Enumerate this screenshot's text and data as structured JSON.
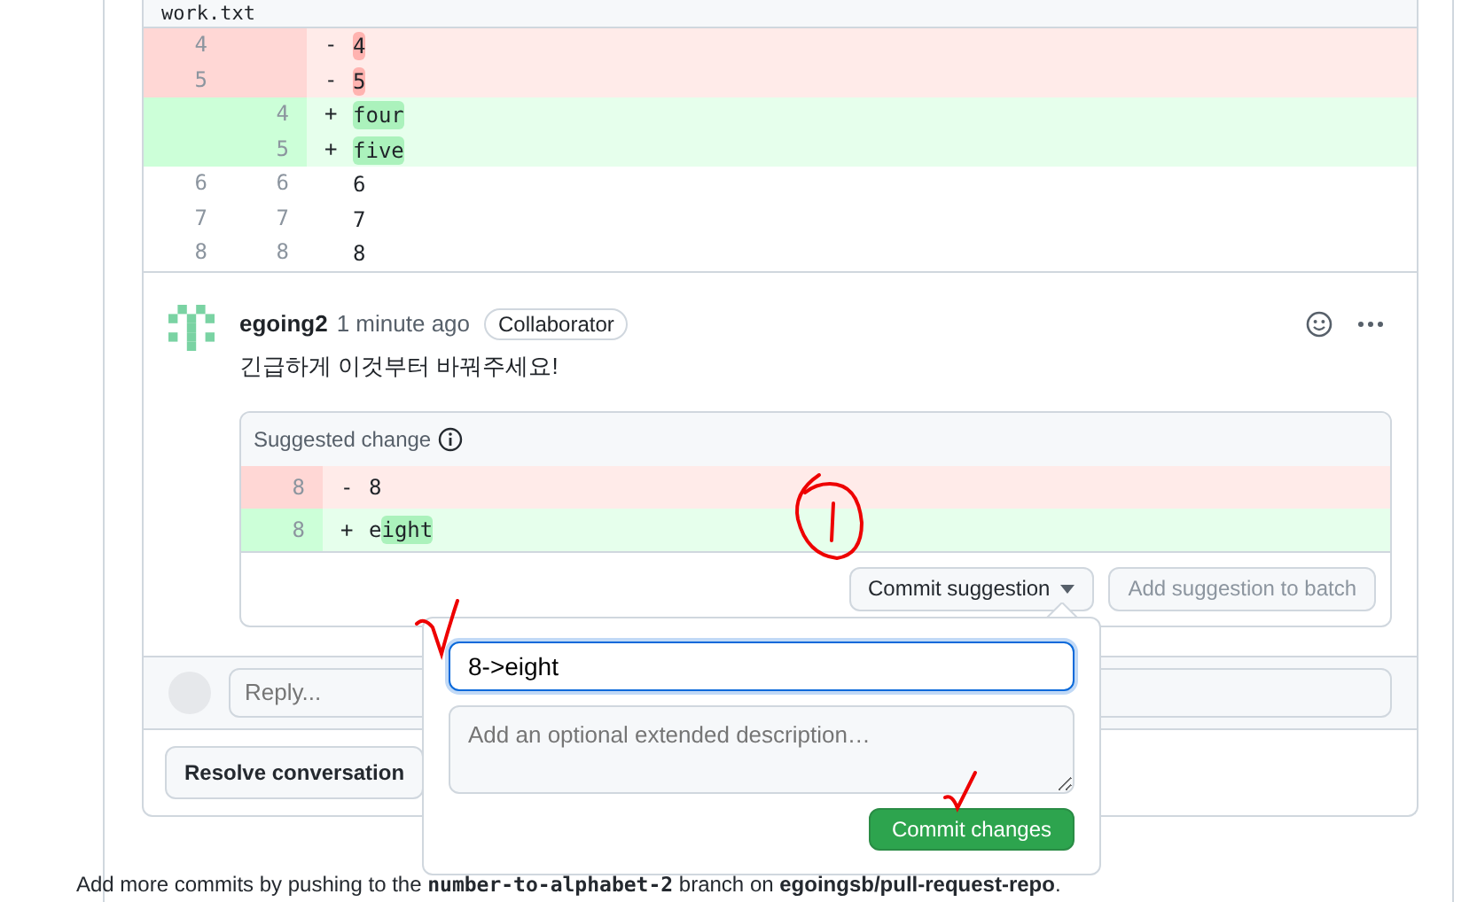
{
  "file": {
    "name": "work.txt",
    "lines": [
      {
        "kind": "deleted",
        "old": "4",
        "sign": "-",
        "segments": [
          {
            "text": "4",
            "marked": true
          }
        ]
      },
      {
        "kind": "deleted",
        "old": "5",
        "sign": "-",
        "segments": [
          {
            "text": "5",
            "marked": true
          }
        ]
      },
      {
        "kind": "added",
        "new": "4",
        "sign": "+",
        "segments": [
          {
            "text": "four",
            "marked": true
          }
        ]
      },
      {
        "kind": "added",
        "new": "5",
        "sign": "+",
        "segments": [
          {
            "text": "five",
            "marked": true
          }
        ]
      },
      {
        "kind": "context",
        "old": "6",
        "new": "6",
        "segments": [
          {
            "text": "6",
            "marked": false
          }
        ]
      },
      {
        "kind": "context",
        "old": "7",
        "new": "7",
        "segments": [
          {
            "text": "7",
            "marked": false
          }
        ]
      },
      {
        "kind": "context",
        "old": "8",
        "new": "8",
        "segments": [
          {
            "text": "8",
            "marked": false
          }
        ]
      }
    ]
  },
  "comment": {
    "author": "egoing2",
    "time": "1 minute ago",
    "badge": "Collaborator",
    "body": "긴급하게 이것부터 바꿔주세요!",
    "suggestion": {
      "title": "Suggested change",
      "lines": [
        {
          "kind": "deleted",
          "number": "8",
          "sign": "-",
          "segments": [
            {
              "text": "8",
              "marked": false
            }
          ]
        },
        {
          "kind": "added",
          "number": "8",
          "sign": "+",
          "segments": [
            {
              "text": "e",
              "marked": false
            },
            {
              "text": "ight",
              "marked": true
            }
          ]
        }
      ],
      "buttons": [
        {
          "label": "Commit suggestion",
          "kind": "dropdown",
          "disabled": false
        },
        {
          "label": "Add suggestion to batch",
          "kind": "plain",
          "disabled": true
        }
      ]
    }
  },
  "reply": {
    "placeholder": "Reply..."
  },
  "resolve_button": "Resolve conversation",
  "commit_popover": {
    "message": "8->eight",
    "description_placeholder": "Add an optional extended description…",
    "button": "Commit changes"
  },
  "footer": "Add more commits by pushing to the **number-to-alphabet-2** branch on **egoingsb/pull-request-repo**."
}
